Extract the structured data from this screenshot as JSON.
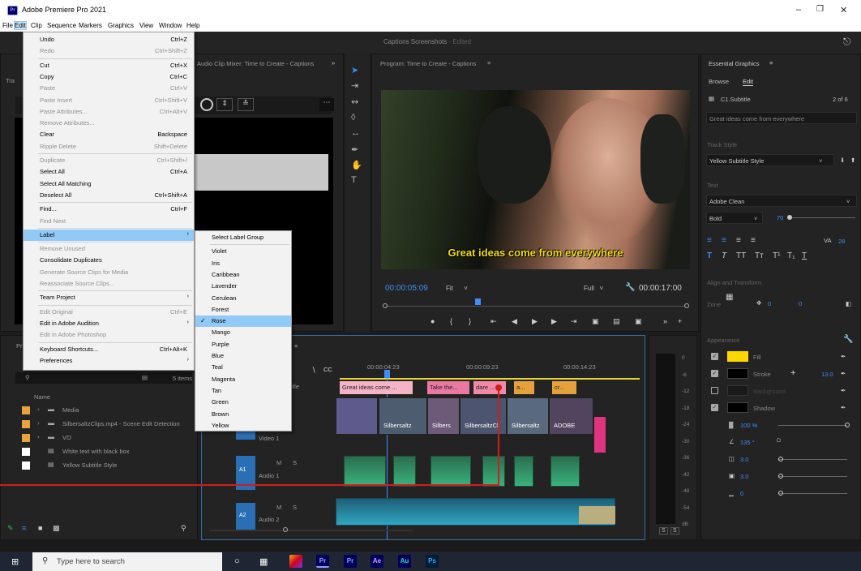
{
  "app": {
    "title": "Adobe Premiere Pro 2021",
    "logo_text": "Pr"
  },
  "menubar": [
    "File",
    "Edit",
    "Clip",
    "Sequence",
    "Markers",
    "Graphics",
    "View",
    "Window",
    "Help"
  ],
  "header": {
    "project": "Captions Screenshots",
    "status": "- Edited"
  },
  "source_panel": {
    "title": "Audio Clip Mixer: Time to Create - Captions",
    "tab_fragment": "Tra"
  },
  "program": {
    "title": "Program: Time to Create - Captions",
    "subtitle": "Great ideas come from everywhere",
    "timecode": "00:00:05:09",
    "fit": "Fit",
    "quality": "Full",
    "duration": "00:00:17:00"
  },
  "essential_graphics": {
    "title": "Essential Graphics",
    "tabs": [
      "Browse",
      "Edit"
    ],
    "layer": "C1.Subtitle",
    "layer_count": "2 of 6",
    "layer_text": "Great ideas come from everywhere",
    "track_style_label": "Track Style",
    "track_style": "Yellow Subtitle Style",
    "text_label": "Text",
    "font": "Adobe Clean",
    "weight": "Bold",
    "size": "70",
    "tracking": "28",
    "align_label": "Align and Transform",
    "zone": "Zone",
    "pos_x": "0",
    "pos_y": "0",
    "appearance_label": "Appearance",
    "fill": "Fill",
    "stroke": "Stroke",
    "stroke_width": "13.0",
    "background": "Background",
    "shadow": "Shadow",
    "opacity": "100 %",
    "angle": "135 °",
    "distance": "3.0",
    "size2": "3.0",
    "blur": "0",
    "fill_color": "#ffd700"
  },
  "project": {
    "tab": "Pr",
    "items_count": "5 items",
    "name_header": "Name",
    "items": [
      {
        "name": "Media",
        "color": "#e8a33c",
        "folder": true
      },
      {
        "name": "SilbersaltzClips.mp4 - Scene Edit Detection",
        "color": "#e8a33c",
        "folder": true
      },
      {
        "name": "VO",
        "color": "#e8a33c",
        "folder": true
      },
      {
        "name": "White text with black box",
        "color": "#ffffff",
        "folder": false
      },
      {
        "name": "Yellow Subtitle Style",
        "color": "#ffffff",
        "folder": false
      }
    ]
  },
  "timeline": {
    "times": [
      "00:00:04:23",
      "00:00:09:23",
      "00:00:14:23"
    ],
    "subtitle_track": "Subtitle",
    "captions": [
      "Great ideas come ...",
      "Take the...",
      "dare ...",
      "a...",
      "cr..."
    ],
    "video_track": "Video 1",
    "v1": "V1",
    "audio1": "Audio 1",
    "a1": "A1",
    "audio2": "Audio 2",
    "a2": "A2",
    "clip_labels": [
      "Silbersaltz",
      "Silbers",
      "SilbersaltzCl",
      "Silbersaltz",
      "ADOBE"
    ],
    "m": "M",
    "s": "S"
  },
  "meter": {
    "scale": [
      "0",
      "-6",
      "-12",
      "-18",
      "-24",
      "-30",
      "-36",
      "-42",
      "-48",
      "-54",
      "dB"
    ],
    "solo": [
      "S",
      "S"
    ]
  },
  "edit_menu": [
    {
      "label": "Undo",
      "key": "Ctrl+Z"
    },
    {
      "label": "Redo",
      "key": "Ctrl+Shift+Z",
      "dis": true
    },
    "sep",
    {
      "label": "Cut",
      "key": "Ctrl+X"
    },
    {
      "label": "Copy",
      "key": "Ctrl+C"
    },
    {
      "label": "Paste",
      "key": "Ctrl+V",
      "dis": true
    },
    {
      "label": "Paste Insert",
      "key": "Ctrl+Shift+V",
      "dis": true
    },
    {
      "label": "Paste Attributes...",
      "key": "Ctrl+Alt+V",
      "dis": true
    },
    {
      "label": "Remove Attributes...",
      "key": "",
      "dis": true
    },
    {
      "label": "Clear",
      "key": "Backspace"
    },
    {
      "label": "Ripple Delete",
      "key": "Shift+Delete",
      "dis": true
    },
    "sep",
    {
      "label": "Duplicate",
      "key": "Ctrl+Shift+/",
      "dis": true
    },
    {
      "label": "Select All",
      "key": "Ctrl+A"
    },
    {
      "label": "Select All Matching",
      "key": ""
    },
    {
      "label": "Deselect All",
      "key": "Ctrl+Shift+A"
    },
    "sep",
    {
      "label": "Find...",
      "key": "Ctrl+F"
    },
    {
      "label": "Find Next",
      "key": "",
      "dis": true
    },
    "sep",
    {
      "label": "Label",
      "key": "",
      "sub": true,
      "hl": true
    },
    "sep",
    {
      "label": "Remove Unused",
      "key": "",
      "dis": true
    },
    {
      "label": "Consolidate Duplicates",
      "key": ""
    },
    {
      "label": "Generate Source Clips for Media",
      "key": "",
      "dis": true
    },
    {
      "label": "Reassociate Source Clips...",
      "key": "",
      "dis": true
    },
    "sep",
    {
      "label": "Team Project",
      "key": "",
      "sub": true
    },
    "sep",
    {
      "label": "Edit Original",
      "key": "Ctrl+E",
      "dis": true
    },
    {
      "label": "Edit in Adobe Audition",
      "key": "",
      "sub": true
    },
    {
      "label": "Edit in Adobe Photoshop",
      "key": "",
      "dis": true
    },
    "sep",
    {
      "label": "Keyboard Shortcuts...",
      "key": "Ctrl+Alt+K"
    },
    {
      "label": "Preferences",
      "key": "",
      "sub": true
    }
  ],
  "label_menu": [
    "Select Label Group",
    "sep",
    "Violet",
    "Iris",
    "Caribbean",
    "Lavender",
    "Cerulean",
    "Forest",
    "Rose",
    "Mango",
    "Purple",
    "Blue",
    "Teal",
    "Magenta",
    "Tan",
    "Green",
    "Brown",
    "Yellow"
  ],
  "label_checked": "Rose",
  "taskbar": {
    "search": "Type here to search",
    "apps": [
      "Pr",
      "Pr",
      "Ae",
      "Au",
      "Ps"
    ]
  }
}
